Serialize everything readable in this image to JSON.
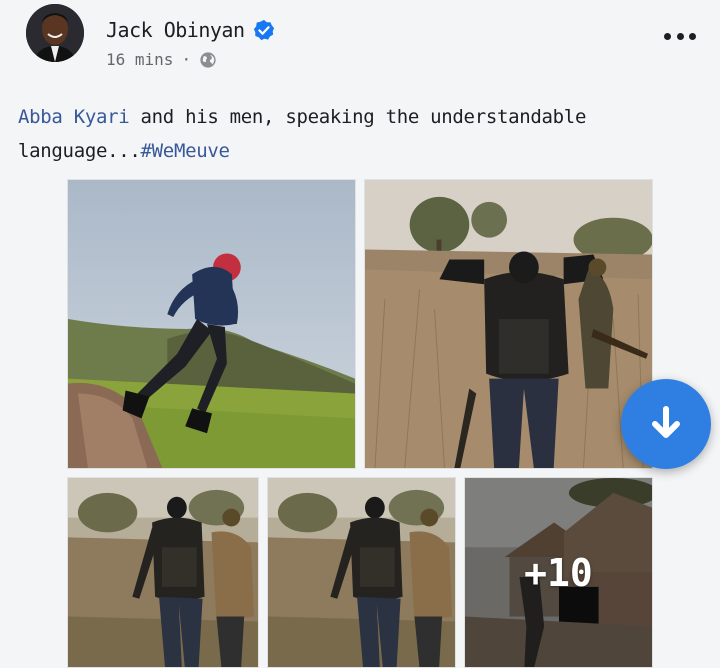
{
  "author": {
    "name": "Jack Obinyan",
    "verified": true
  },
  "meta": {
    "time": "16 mins",
    "separator": "·",
    "privacy_icon": "globe-icon"
  },
  "post": {
    "mention": "Abba Kyari",
    "text": " and his men, speaking the understandable language...",
    "hashtag": "#WeMeuve"
  },
  "photos": {
    "more_count": "+10"
  },
  "colors": {
    "link": "#385898",
    "verified": "#1877f2",
    "download_button": "#2f7fe3"
  },
  "icons": {
    "more": "more-options-icon",
    "download": "download-arrow-icon"
  }
}
